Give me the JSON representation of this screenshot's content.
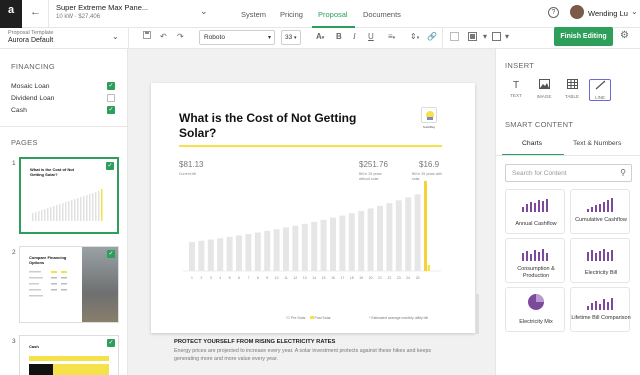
{
  "topbar": {
    "project_title": "Super Extreme Max Pane...",
    "project_size": "10 kW",
    "project_price": "$27,406",
    "tabs": [
      "System",
      "Pricing",
      "Proposal",
      "Documents"
    ],
    "active_tab": "Proposal",
    "user_name": "Wending Lu"
  },
  "toolbar": {
    "template_label": "Proposal Template",
    "template_value": "Aurora Default",
    "font_family": "Roboto",
    "font_size": "33",
    "finish_label": "Finish Editing"
  },
  "left_panel": {
    "financing_heading": "FINANCING",
    "financing_items": [
      {
        "label": "Mosaic Loan",
        "checked": true
      },
      {
        "label": "Dividend Loan",
        "checked": false
      },
      {
        "label": "Cash",
        "checked": true
      }
    ],
    "pages_heading": "PAGES",
    "pages": [
      {
        "number": "1",
        "title": "What is the Cost of Not Getting Solar?",
        "selected": true
      },
      {
        "number": "2",
        "title": "Compare Financing Options",
        "selected": false
      },
      {
        "number": "3",
        "title": "Cash",
        "selected": false
      }
    ]
  },
  "page": {
    "title": "What is the Cost of Not Getting Solar?",
    "logo_text": "SolarBay",
    "stat_current": {
      "value": "$81.13",
      "label": "Current bill"
    },
    "stat_mid": {
      "value": "$251.76",
      "label": "Bill in 25 years without solar"
    },
    "stat_right": {
      "value": "$16.9",
      "label": "Bill in 25 years with solar"
    },
    "legend_no_solar": "Pre Solar",
    "legend_solar": "Post Solar",
    "note": "* Estimated average monthly utility bill",
    "section_heading": "PROTECT YOURSELF FROM RISING ELECTRICITY RATES",
    "body": "Energy prices are projected to increase every year. A solar investment protects against these hikes and keeps generating more and more value every year."
  },
  "chart_data": {
    "type": "bar",
    "series": [
      {
        "name": "Pre Solar",
        "values": [
          81.13,
          84.5,
          88.0,
          91.6,
          95.4,
          99.3,
          103.4,
          107.7,
          112.2,
          116.8,
          121.6,
          126.6,
          131.9,
          137.3,
          143.0,
          148.9,
          155.0,
          161.4,
          168.1,
          175.0,
          182.3,
          189.8,
          197.6,
          205.8,
          214.3,
          251.76
        ]
      },
      {
        "name": "Post Solar",
        "values": [
          0,
          0,
          0,
          0,
          0,
          0,
          0,
          0,
          0,
          0,
          0,
          0,
          0,
          0,
          0,
          0,
          0,
          0,
          0,
          0,
          0,
          0,
          0,
          0,
          0,
          16.9
        ]
      }
    ],
    "x_ticks": [
      "1",
      "2",
      "3",
      "4",
      "5",
      "6",
      "7",
      "8",
      "9",
      "10",
      "11",
      "12",
      "13",
      "14",
      "15",
      "16",
      "17",
      "18",
      "19",
      "20",
      "21",
      "22",
      "23",
      "24",
      "25"
    ],
    "highlight_index": 25,
    "colors": {
      "pre": "#e6e6e6",
      "post": "#f5e14a",
      "highlight": "#f3d23a"
    }
  },
  "right_panel": {
    "insert_heading": "INSERT",
    "insert_tools": [
      {
        "label": "TEXT",
        "icon": "text-icon"
      },
      {
        "label": "IMAGE",
        "icon": "image-icon"
      },
      {
        "label": "TABLE",
        "icon": "table-icon"
      },
      {
        "label": "LINE",
        "icon": "line-icon"
      }
    ],
    "smart_heading": "SMART CONTENT",
    "tabs": [
      "Charts",
      "Text & Numbers"
    ],
    "search_placeholder": "Search for Content",
    "cards": [
      {
        "label": "Annual Cashflow"
      },
      {
        "label": "Cumulative Cashflow"
      },
      {
        "label": "Consumption & Production"
      },
      {
        "label": "Electricity Bill"
      },
      {
        "label": "Electricity Mix"
      },
      {
        "label": "Lifetime Bill Comparison"
      }
    ]
  },
  "accent_color": "#2e9e5b"
}
